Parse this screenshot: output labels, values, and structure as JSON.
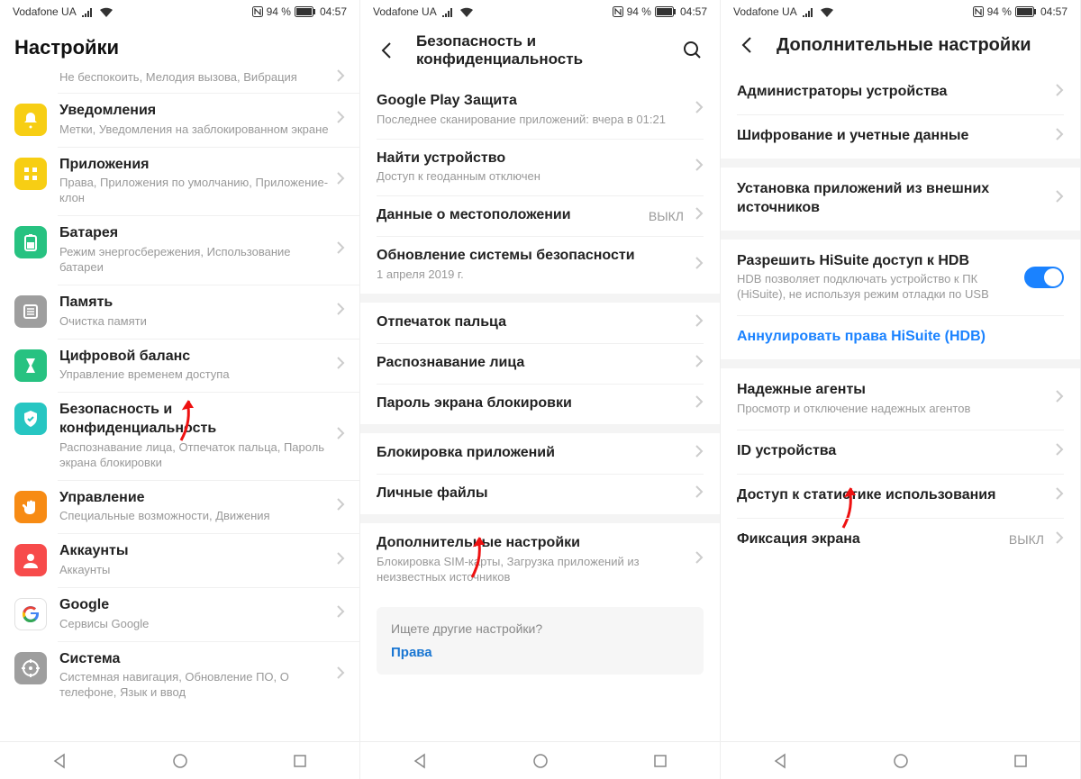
{
  "status": {
    "carrier": "Vodafone UA",
    "battery_text": "94 %",
    "time": "04:57"
  },
  "screen1": {
    "title": "Настройки",
    "rows": [
      {
        "icon_bg": "#a15bd9",
        "glyph": "moon",
        "title": "",
        "sub": "Не беспокоить, Мелодия вызова, Вибрация"
      },
      {
        "icon_bg": "#f7ce14",
        "glyph": "bell",
        "title": "Уведомления",
        "sub": "Метки, Уведомления на заблокированном экране"
      },
      {
        "icon_bg": "#f7ce14",
        "glyph": "grid",
        "title": "Приложения",
        "sub": "Права, Приложения по умолчанию, Приложение-клон"
      },
      {
        "icon_bg": "#27c281",
        "glyph": "battery",
        "title": "Батарея",
        "sub": "Режим энергосбережения, Использование батареи"
      },
      {
        "icon_bg": "#9e9e9e",
        "glyph": "memory",
        "title": "Память",
        "sub": "Очистка памяти"
      },
      {
        "icon_bg": "#27c281",
        "glyph": "hourglass",
        "title": "Цифровой баланс",
        "sub": "Управление временем доступа"
      },
      {
        "icon_bg": "#27c6c2",
        "glyph": "shield",
        "title": "Безопасность и конфиденциальность",
        "sub": "Распознавание лица, Отпечаток пальца, Пароль экрана блокировки"
      },
      {
        "icon_bg": "#f78b14",
        "glyph": "hand",
        "title": "Управление",
        "sub": "Специальные возможности, Движения"
      },
      {
        "icon_bg": "#f74b4b",
        "glyph": "user",
        "title": "Аккаунты",
        "sub": "Аккаунты"
      },
      {
        "icon_bg": "#ffffff",
        "glyph": "google",
        "title": "Google",
        "sub": "Сервисы Google"
      },
      {
        "icon_bg": "#9e9e9e",
        "glyph": "system",
        "title": "Система",
        "sub": "Системная навигация, Обновление ПО, О телефоне, Язык и ввод"
      }
    ]
  },
  "screen2": {
    "title": "Безопасность и конфиденциальность",
    "groups": [
      [
        {
          "title": "Google Play Защита",
          "sub": "Последнее сканирование приложений: вчера в 01:21"
        },
        {
          "title": "Найти устройство",
          "sub": "Доступ к геоданным отключен"
        },
        {
          "title": "Данные о местоположении",
          "value": "ВЫКЛ"
        },
        {
          "title": "Обновление системы безопасности",
          "sub": "1 апреля 2019 г."
        }
      ],
      [
        {
          "title": "Отпечаток пальца"
        },
        {
          "title": "Распознавание лица"
        },
        {
          "title": "Пароль экрана блокировки"
        }
      ],
      [
        {
          "title": "Блокировка приложений"
        },
        {
          "title": "Личные файлы"
        }
      ],
      [
        {
          "title": "Дополнительные настройки",
          "sub": "Блокировка SIM-карты, Загрузка приложений из неизвестных источников"
        }
      ]
    ],
    "search_hint": "Ищете другие настройки?",
    "search_link": "Права"
  },
  "screen3": {
    "title": "Дополнительные настройки",
    "groups": [
      [
        {
          "title": "Администраторы устройства"
        },
        {
          "title": "Шифрование и учетные данные"
        }
      ],
      [
        {
          "title": "Установка приложений из внешних источников"
        }
      ],
      [
        {
          "title": "Разрешить HiSuite доступ к HDB",
          "sub": "HDB позволяет подключать устройство к ПК (HiSuite), не используя режим отладки по USB",
          "toggle": true
        },
        {
          "title": "Аннулировать права HiSuite (HDB)",
          "link": true
        }
      ],
      [
        {
          "title": "Надежные агенты",
          "sub": "Просмотр и отключение надежных агентов"
        },
        {
          "title": "ID устройства"
        },
        {
          "title": "Доступ к статистике использования"
        },
        {
          "title": "Фиксация экрана",
          "value": "ВЫКЛ"
        }
      ]
    ]
  }
}
